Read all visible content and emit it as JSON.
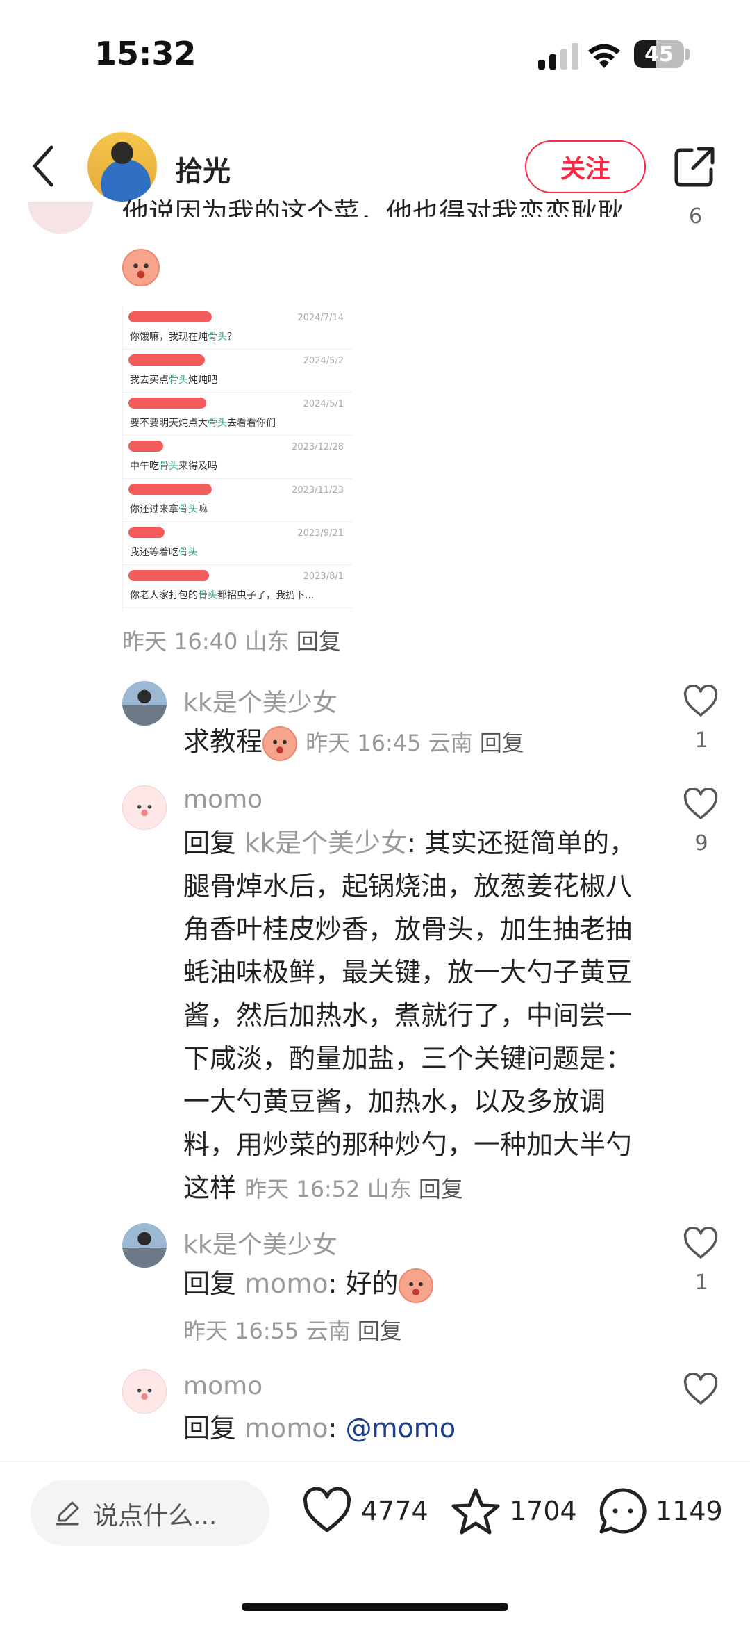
{
  "status_bar": {
    "time": "15:32",
    "battery": "45",
    "battery_level": 0.45
  },
  "header": {
    "username": "拾光",
    "follow_label": "关注"
  },
  "parent_comment": {
    "cut_text": "他说因为我的这个菜，他也得对我恋恋耿耿",
    "cut_like_count": "6",
    "meta_time": "昨天 16:40",
    "meta_location": "山东",
    "meta_reply": "回复",
    "screenshot_rows": [
      {
        "date": "2024/7/14",
        "pre": "你饿嘛，我现在炖",
        "kw": "骨头",
        "post": "？"
      },
      {
        "date": "2024/5/2",
        "pre": "我去买点",
        "kw": "骨头",
        "post": "炖炖吧"
      },
      {
        "date": "2024/5/1",
        "pre": "要不要明天炖点大",
        "kw": "骨头",
        "post": "去看看你们"
      },
      {
        "date": "2023/12/28",
        "pre": "中午吃",
        "kw": "骨头",
        "post": "来得及吗"
      },
      {
        "date": "2023/11/23",
        "pre": "你还过来拿",
        "kw": "骨头",
        "post": "嘛"
      },
      {
        "date": "2023/9/21",
        "pre": "我还等着吃",
        "kw": "骨头",
        "post": ""
      },
      {
        "date": "2023/8/1",
        "pre": "你老人家打包的",
        "kw": "骨头",
        "post": "都招虫子了，我扔下..."
      }
    ]
  },
  "replies": [
    {
      "author": "kk是个美少女",
      "text": "求教程",
      "time": "昨天 16:45",
      "location": "云南",
      "reply_label": "回复",
      "likes": "1"
    },
    {
      "author": "momo",
      "reply_prefix": "回复",
      "reply_to": "kk是个美少女",
      "text": ": 其实还挺简单的，腿骨焯水后，起锅烧油，放葱姜花椒八角香叶桂皮炒香，放骨头，加生抽老抽蚝油味极鲜，最关键，放一大勺子黄豆酱，然后加热水，煮就行了，中间尝一下咸淡，酌量加盐，三个关键问题是：一大勺黄豆酱，加热水，以及多放调料，用炒菜的那种炒勺，一种加大半勺这样",
      "time": "昨天 16:52",
      "location": "山东",
      "reply_label": "回复",
      "likes": "9"
    },
    {
      "author": "kk是个美少女",
      "reply_prefix": "回复",
      "reply_to": "momo",
      "text": ": 好的",
      "time": "昨天 16:55",
      "location": "云南",
      "reply_label": "回复",
      "likes": "1"
    },
    {
      "author": "momo",
      "reply_prefix": "回复",
      "reply_to": "momo",
      "colon": ": ",
      "mention": "@momo"
    }
  ],
  "bottom_bar": {
    "input_placeholder": "说点什么...",
    "likes": "4774",
    "favorites": "1704",
    "comments": "1149"
  }
}
